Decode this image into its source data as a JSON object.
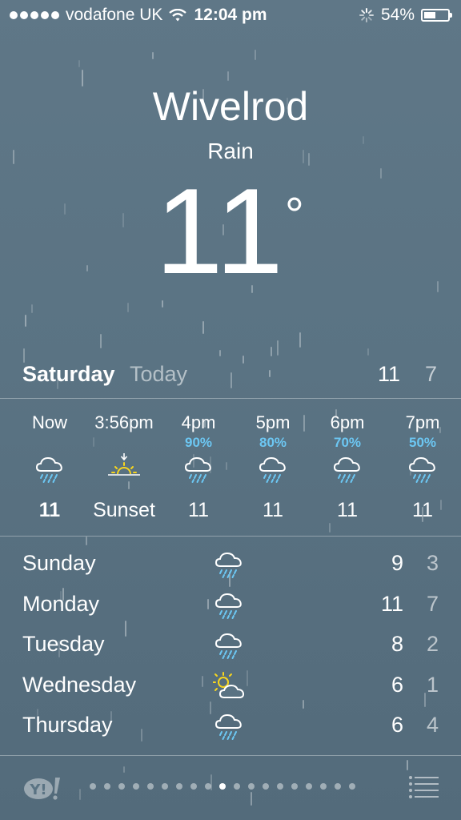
{
  "status": {
    "carrier": "vodafone UK",
    "time": "12:04 pm",
    "battery": "54%",
    "battery_level": 0.54,
    "icons": [
      "signal-dots-icon",
      "wifi-icon",
      "activity-spinner-icon",
      "battery-icon"
    ]
  },
  "location": {
    "city": "Wivelrod",
    "condition": "Rain",
    "temperature": "11",
    "degree_symbol": "°"
  },
  "today": {
    "day": "Saturday",
    "label": "Today",
    "high": "11",
    "low": "7"
  },
  "hourly": [
    {
      "time": "Now",
      "precip": "",
      "temp": "11",
      "icon": "rain-cloud-icon",
      "bold": true
    },
    {
      "time": "3:56pm",
      "precip": "",
      "temp": "Sunset",
      "icon": "sunset-icon",
      "bold": false
    },
    {
      "time": "4pm",
      "precip": "90%",
      "temp": "11",
      "icon": "rain-cloud-icon",
      "bold": false
    },
    {
      "time": "5pm",
      "precip": "80%",
      "temp": "11",
      "icon": "rain-cloud-icon",
      "bold": false
    },
    {
      "time": "6pm",
      "precip": "70%",
      "temp": "11",
      "icon": "rain-cloud-icon",
      "bold": false
    },
    {
      "time": "7pm",
      "precip": "50%",
      "temp": "11",
      "icon": "rain-cloud-icon",
      "bold": false
    }
  ],
  "daily": [
    {
      "day": "Sunday",
      "icon": "rain-cloud-icon",
      "high": "9",
      "low": "3"
    },
    {
      "day": "Monday",
      "icon": "rain-cloud-icon",
      "high": "11",
      "low": "7"
    },
    {
      "day": "Tuesday",
      "icon": "rain-cloud-icon",
      "high": "8",
      "low": "2"
    },
    {
      "day": "Wednesday",
      "icon": "sun-cloud-icon",
      "high": "6",
      "low": "1"
    },
    {
      "day": "Thursday",
      "icon": "rain-cloud-icon",
      "high": "6",
      "low": "4"
    }
  ],
  "footer": {
    "logo": "Y!",
    "page_count": 19,
    "active_page": 9,
    "icons": [
      "yahoo-logo-icon",
      "list-icon"
    ]
  },
  "colors": {
    "background": "#5a7383",
    "precip_blue": "#6cc7f3",
    "sun_yellow": "#f7d51d"
  }
}
